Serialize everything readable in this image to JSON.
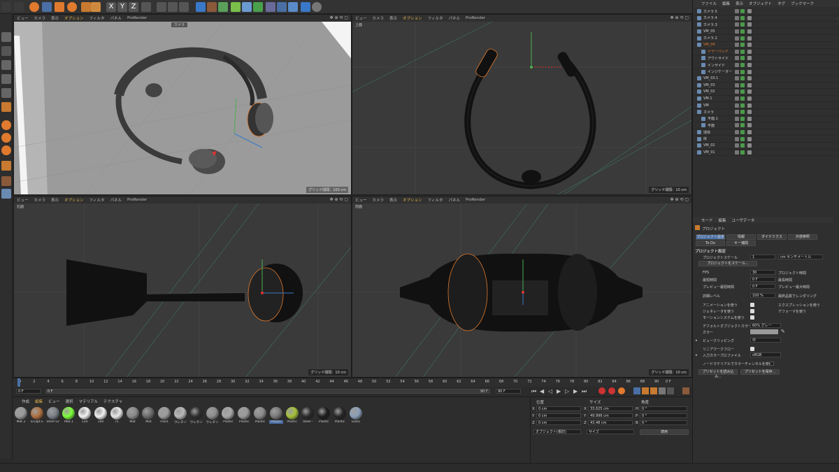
{
  "viewport_menu": [
    "ビュー",
    "カメラ",
    "表示",
    "オプション",
    "フィルタ",
    "パネル",
    "ProRender"
  ],
  "viewports": [
    {
      "label": "",
      "grid": "グリッド間隔：100 cm",
      "camera": "カメラ"
    },
    {
      "label": "上面",
      "grid": "グリッド間隔：10 cm"
    },
    {
      "label": "右面",
      "grid": "グリッド間隔：10 cm"
    },
    {
      "label": "前面",
      "grid": "グリッド間隔：10 cm"
    }
  ],
  "object_manager": {
    "menu": [
      "ファイル",
      "編集",
      "表示",
      "オブジェクト",
      "タグ",
      "ブックマーク"
    ],
    "rows": [
      {
        "name": "カメラ.5",
        "indent": 0
      },
      {
        "name": "カメラ.4",
        "indent": 0
      },
      {
        "name": "カメラ.3",
        "indent": 0
      },
      {
        "name": "VM_05",
        "indent": 0
      },
      {
        "name": "カメラ.2",
        "indent": 0
      },
      {
        "name": "VM_04",
        "indent": 0,
        "accent": true
      },
      {
        "name": "イヤーパッド",
        "indent": 1,
        "accent": true
      },
      {
        "name": "アウトサイド",
        "indent": 1
      },
      {
        "name": "インサイド",
        "indent": 1
      },
      {
        "name": "インジケーター",
        "indent": 1
      },
      {
        "name": "VM_03.1",
        "indent": 0
      },
      {
        "name": "VM_03",
        "indent": 0
      },
      {
        "name": "VM_02",
        "indent": 0
      },
      {
        "name": "VM.1",
        "indent": 0
      },
      {
        "name": "VM",
        "indent": 0
      },
      {
        "name": "カメラ",
        "indent": 0
      },
      {
        "name": "平面.1",
        "indent": 1
      },
      {
        "name": "平面",
        "indent": 1
      },
      {
        "name": "球体",
        "indent": 0
      },
      {
        "name": "床",
        "indent": 0
      },
      {
        "name": "VM_02",
        "indent": 0
      },
      {
        "name": "VM_01",
        "indent": 0
      }
    ]
  },
  "attribute_manager": {
    "menu": [
      "モード",
      "編集",
      "ユーザデータ"
    ],
    "title": "プロジェクト",
    "tabs": [
      "プロジェクト設定",
      "情報",
      "ダイナミクス",
      "外部参照",
      "To Do",
      "キー補間"
    ],
    "section": "プロジェクト設定",
    "scale_label": "プロジェクトスケール",
    "scale_value": "1",
    "scale_unit": "cm センチメートル",
    "scale_button": "プロジェクトをスケール...",
    "fps_label": "FPS",
    "fps_value": "30",
    "min_time_label": "最短時間",
    "min_time_value": "0 F",
    "preview_min_label": "プレビュー最短時間",
    "preview_min_value": "0 F",
    "lod_label": "詳細レベル",
    "lod_value": "100 %",
    "project_time_label": "プロジェクト時間",
    "max_time_label": "最長時間",
    "preview_max_label": "プレビュー最大時間",
    "render_lod_label": "最終品質でレンダリング",
    "use_anim_label": "アニメーションを使う",
    "use_gen_label": "ジェネレータを使う",
    "use_motion_label": "モーションシステムを使う",
    "use_expr_label": "エクスプレッションを使う",
    "use_deform_label": "デフォーマを使う",
    "default_color_label": "デフォルトオブジェクトカラー",
    "default_color_value": "60% グレー",
    "color_label": "カラー",
    "clipping_label": "ビュークリッピング",
    "clipping_value": "中",
    "linear_label": "リニアワークフロー",
    "input_profile_label": "入力カラープロファイル",
    "input_profile_value": "sRGB",
    "node_label": "ノードマテリアルでカラーチャンネルを使用",
    "load_preset": "プリセットを読み込み...",
    "save_preset": "プリセットを保存..."
  },
  "timeline": {
    "ticks": [
      "0",
      "2",
      "4",
      "6",
      "8",
      "10",
      "12",
      "14",
      "16",
      "18",
      "20",
      "22",
      "24",
      "26",
      "28",
      "30",
      "32",
      "34",
      "36",
      "38",
      "40",
      "42",
      "44",
      "46",
      "48",
      "50",
      "52",
      "54",
      "56",
      "58",
      "60",
      "62",
      "64",
      "66",
      "68",
      "70",
      "72",
      "74",
      "76",
      "78",
      "80",
      "82",
      "84",
      "86",
      "88",
      "90"
    ],
    "current": "0 F",
    "start": "0 F",
    "field2": "0 F",
    "end": "90 F",
    "end2": "90 F"
  },
  "material_manager": {
    "menu": [
      "作成",
      "編集",
      "ビュー",
      "選択",
      "マテリアル",
      "テクスチャ"
    ],
    "materials": [
      {
        "name": "Mat.2",
        "color": "#9a9a9a"
      },
      {
        "name": "Sculpt E",
        "color": "#b07040"
      },
      {
        "name": "Steel Gr",
        "color": "#7a8088"
      },
      {
        "name": "Mat.1",
        "color": "#7dff3a"
      },
      {
        "name": "120",
        "color": "#f2f2f2"
      },
      {
        "name": "100",
        "color": "#f0f0f0"
      },
      {
        "name": "75",
        "color": "#e8e8e8"
      },
      {
        "name": "Mat",
        "color": "#8a8a8a"
      },
      {
        "name": "Mat",
        "color": "#6c6c6c"
      },
      {
        "name": "mat1",
        "color": "#9c9c9c"
      },
      {
        "name": "ウレタン",
        "color": "#b8b8b8"
      },
      {
        "name": "ウレタン",
        "color": "#303030"
      },
      {
        "name": "ウレタン",
        "color": "#8e8e8e"
      },
      {
        "name": "Plastic",
        "color": "#a8a8a8"
      },
      {
        "name": "Plastic",
        "color": "#9a9a9a"
      },
      {
        "name": "Plastic",
        "color": "#8a8a8a"
      },
      {
        "name": "Plastic",
        "color": "#7a7a7a"
      },
      {
        "name": "Plastic",
        "color": "#a6c23a"
      },
      {
        "name": "Steel -",
        "color": "#2a2a2a"
      },
      {
        "name": "Plastic",
        "color": "#1e1e1e"
      },
      {
        "name": "Plastic",
        "color": "#262626"
      },
      {
        "name": "Glass",
        "color": "#8aa0b8"
      }
    ]
  },
  "coordinates": {
    "headers": [
      "位置",
      "サイズ",
      "角度"
    ],
    "rows": [
      {
        "axis": "X",
        "pos": "0 cm",
        "size_axis": "X",
        "size": "33.625 cm",
        "rot_axis": "H",
        "rot": "0 °"
      },
      {
        "axis": "Y",
        "pos": "0 cm",
        "size_axis": "Y",
        "size": "49.996 cm",
        "rot_axis": "P",
        "rot": "0 °"
      },
      {
        "axis": "Z",
        "pos": "0 cm",
        "size_axis": "Z",
        "size": "43.48 cm",
        "rot_axis": "B",
        "rot": "0 °"
      }
    ],
    "mode": "オブジェクト(相対)",
    "size_mode": "サイズ",
    "apply": "適用"
  },
  "colors": {
    "accent": "#e2b44a",
    "orange": "#e07a2e",
    "select": "#4a6fa5",
    "green": "#7dff3a"
  }
}
